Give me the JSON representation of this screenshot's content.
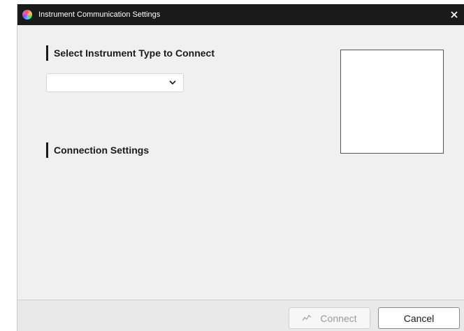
{
  "window": {
    "title": "Instrument Communication Settings",
    "app_icon": "color-wheel-icon",
    "close_icon": "close-icon"
  },
  "instrument_section": {
    "heading": "Select Instrument Type to Connect",
    "dropdown": {
      "selected_value": "",
      "icon": "chevron-down-icon"
    }
  },
  "connection_section": {
    "heading": "Connection Settings"
  },
  "footer": {
    "connect_label": "Connect",
    "connect_icon": "connection-pulse-icon",
    "connect_enabled": false,
    "cancel_label": "Cancel"
  },
  "colors": {
    "titlebar_bg": "#1a1a1a",
    "window_bg": "#f0f0f0",
    "footer_bg": "#e9e9e9",
    "disabled_text": "#9a9a9a"
  }
}
